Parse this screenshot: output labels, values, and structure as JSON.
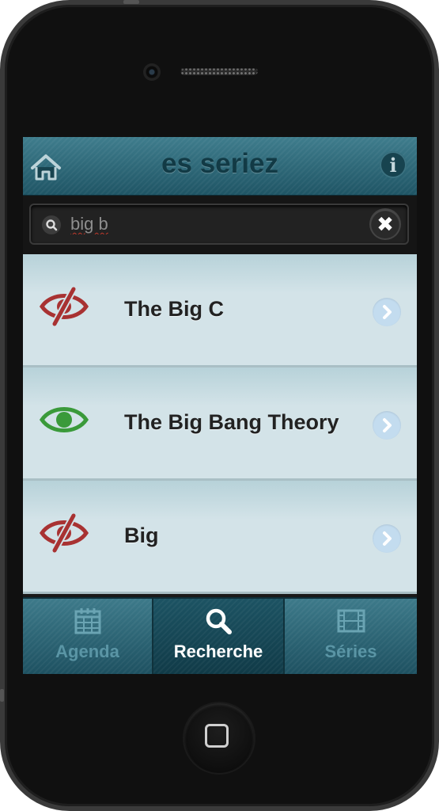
{
  "app": {
    "title": "es seriez"
  },
  "search": {
    "value": "big b"
  },
  "results": [
    {
      "title": "The Big C",
      "watched": false
    },
    {
      "title": "The Big Bang Theory",
      "watched": true
    },
    {
      "title": "Big",
      "watched": false
    }
  ],
  "tabs": [
    {
      "label": "Agenda",
      "icon": "calendar-icon",
      "active": false
    },
    {
      "label": "Recherche",
      "icon": "magnifier-icon",
      "active": true
    },
    {
      "label": "Séries",
      "icon": "film-icon",
      "active": false
    }
  ],
  "colors": {
    "header": "#2f6b7b",
    "watched": "#3a9a3a",
    "not_watched": "#a83232",
    "active_tab_text": "#ffffff",
    "inactive_tab_text": "#5a95a5"
  }
}
